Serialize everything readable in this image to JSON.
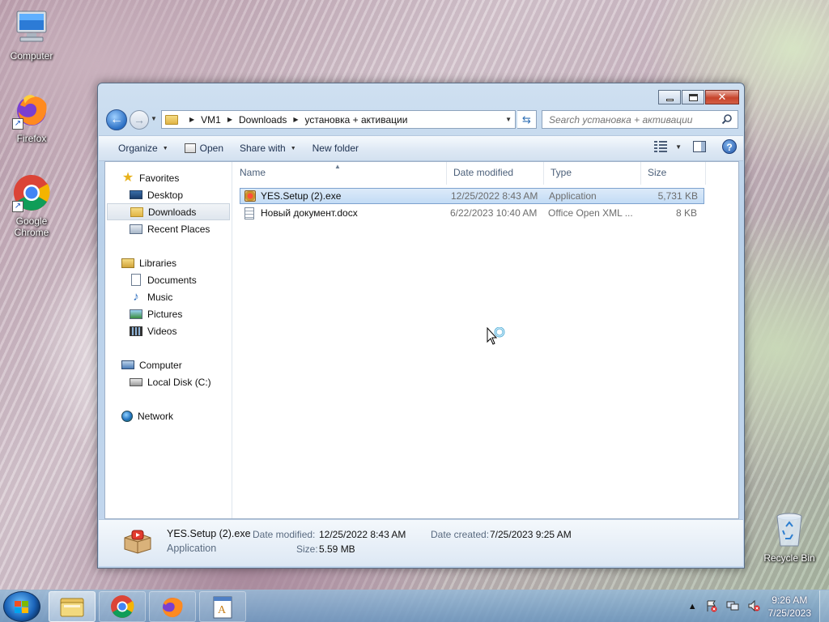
{
  "desktop": {
    "icons": [
      {
        "label": "Computer"
      },
      {
        "label": "Firefox"
      },
      {
        "label": "Google Chrome"
      },
      {
        "label": "Recycle Bin"
      }
    ]
  },
  "window": {
    "address": {
      "crumbs": [
        "VM1",
        "Downloads",
        "установка + активации"
      ]
    },
    "search": {
      "placeholder": "Search установка + активации"
    },
    "toolbar": {
      "organize": "Organize",
      "open": "Open",
      "share_with": "Share with",
      "new_folder": "New folder"
    },
    "nav": {
      "favorites": "Favorites",
      "desktop": "Desktop",
      "downloads": "Downloads",
      "recent_places": "Recent Places",
      "libraries": "Libraries",
      "documents": "Documents",
      "music": "Music",
      "pictures": "Pictures",
      "videos": "Videos",
      "computer": "Computer",
      "local_disk": "Local Disk (C:)",
      "network": "Network"
    },
    "columns": {
      "name": "Name",
      "date": "Date modified",
      "type": "Type",
      "size": "Size"
    },
    "files": [
      {
        "name": "YES.Setup (2).exe",
        "date": "12/25/2022 8:43 AM",
        "type": "Application",
        "size": "5,731 KB",
        "selected": true
      },
      {
        "name": "Новый документ.docx",
        "date": "6/22/2023 10:40 AM",
        "type": "Office Open XML ...",
        "size": "8 KB",
        "selected": false
      }
    ],
    "details": {
      "name": "YES.Setup (2).exe",
      "type": "Application",
      "modified_label": "Date modified:",
      "modified_value": "12/25/2022 8:43 AM",
      "created_label": "Date created:",
      "created_value": "7/25/2023 9:25 AM",
      "size_label": "Size:",
      "size_value": "5.59 MB"
    }
  },
  "taskbar": {
    "clock_time": "9:26 AM",
    "clock_date": "7/25/2023"
  }
}
